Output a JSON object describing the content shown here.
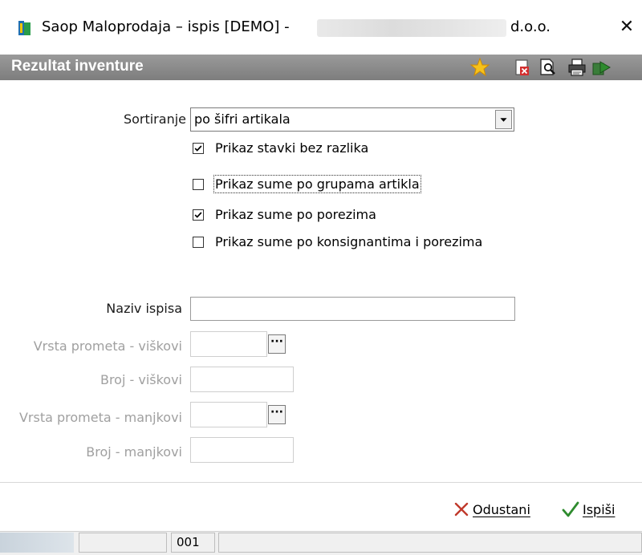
{
  "window": {
    "title": "Saop Maloprodaja – ispis [DEMO] -",
    "title_suffix": "d.o.o.",
    "close_label": "✕"
  },
  "header": {
    "title": "Rezultat inventure"
  },
  "toolbar": {
    "icons": [
      "favorite-star-icon",
      "delete-document-icon",
      "print-preview-icon",
      "printer-icon",
      "export-icon"
    ]
  },
  "form": {
    "sort_label": "Sortiranje",
    "sort_value": "po šifri artikala",
    "options": [
      {
        "label": "Prikaz stavki bez razlika",
        "checked": true
      },
      {
        "label": "Prikaz sume po grupama artikla",
        "checked": false
      },
      {
        "label": "Prikaz sume po porezima",
        "checked": true
      },
      {
        "label": "Prikaz sume po konsignantima i porezima",
        "checked": false
      }
    ],
    "naziv_label": "Naziv ispisa",
    "naziv_value": "",
    "vrsta_viskovi_label": "Vrsta prometa - viškovi",
    "broj_viskovi_label": "Broj - viškovi",
    "vrsta_manjkovi_label": "Vrsta prometa - manjkovi",
    "broj_manjkovi_label": "Broj - manjkovi",
    "ellipsis": "···"
  },
  "actions": {
    "cancel_label": "Odustani",
    "print_label": "Ispiši"
  },
  "statusbar": {
    "code": "001"
  },
  "colors": {
    "header": "#8a8a8a",
    "cancel_red": "#c0392b",
    "ok_green": "#2e8b2e"
  }
}
